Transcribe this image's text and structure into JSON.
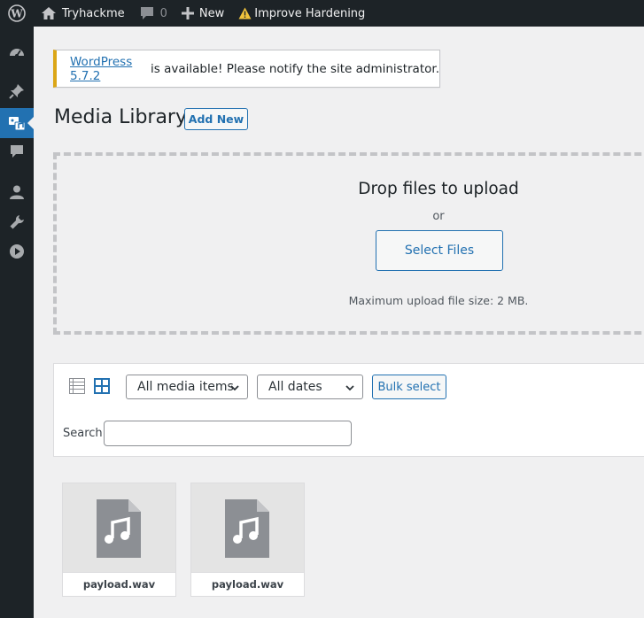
{
  "adminbar": {
    "site_name": "Tryhackme",
    "comments_count": "0",
    "new_label": "New",
    "hardening_label": "Improve Hardening"
  },
  "notice": {
    "link_text": "WordPress 5.7.2",
    "message": " is available! Please notify the site administrator."
  },
  "page": {
    "title": "Media Library",
    "add_new_label": "Add New"
  },
  "uploader": {
    "drop_text": "Drop files to upload",
    "or_text": "or",
    "select_files_label": "Select Files",
    "max_size_text": "Maximum upload file size: 2 MB."
  },
  "toolbar": {
    "media_filter": "All media items",
    "date_filter": "All dates",
    "bulk_select_label": "Bulk select",
    "search_label": "Search",
    "search_value": ""
  },
  "attachments": [
    {
      "filename": "payload.wav"
    },
    {
      "filename": "payload.wav"
    }
  ],
  "colors": {
    "accent": "#2271b1",
    "adminbar": "#1d2327",
    "notice_warning": "#dba617"
  }
}
